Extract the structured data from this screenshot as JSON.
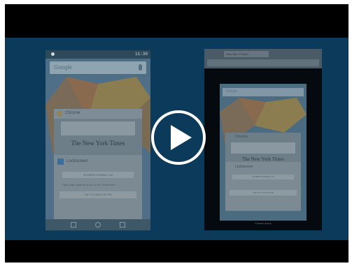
{
  "video": {
    "state": "paused",
    "play_label": "Play",
    "colors": {
      "background": "#0c3a5a",
      "letterbox": "#000000",
      "play": "#ffffff"
    }
  },
  "left_phone": {
    "status_time": "11:30",
    "search_placeholder": "Google",
    "chrome_card_title": "Chrome",
    "chrome_card_headline": "The New York Times",
    "lock_card_title": "Lockscreen",
    "lock_card_button": "SCREEN PINNING ON",
    "lock_card_note": "Hold page address to pin to the lockscreen",
    "lock_card_action": "TAP TO UNLOCK PIN"
  },
  "tablet": {
    "tab_title": "New Tab • Pinned",
    "search_placeholder": "Google",
    "chrome_card_title": "Chrome",
    "chrome_card_headline": "The New York Times",
    "lock_card_title": "Lockscreen",
    "lock_card_button": "SCREEN PINNING ON",
    "lock_card_action": "TAP TO UNLOCK PIN",
    "footer": "© Screen pinning"
  }
}
